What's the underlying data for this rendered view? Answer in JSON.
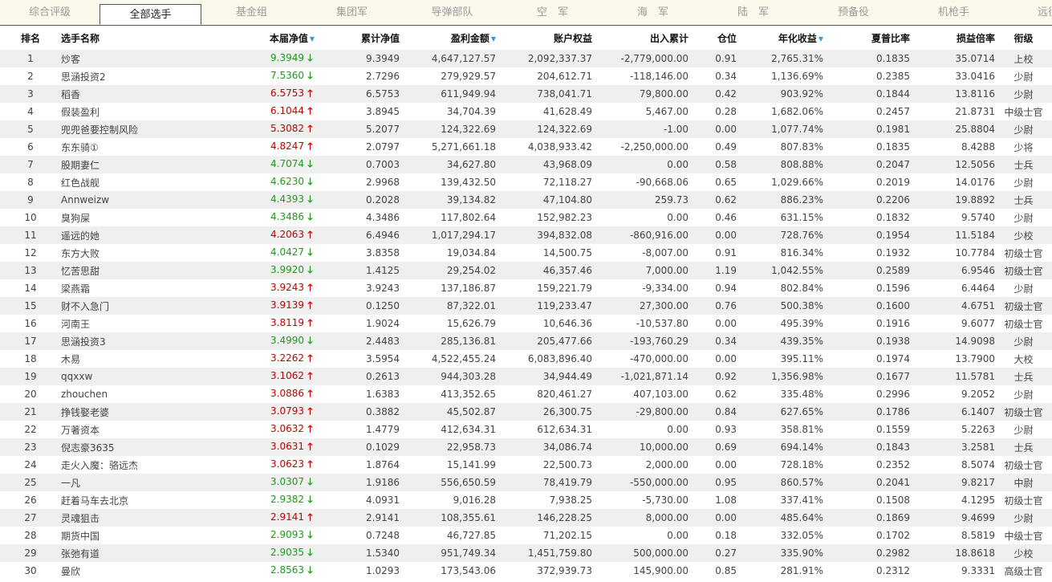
{
  "tabs": [
    "综合评级",
    "全部选手",
    "基金组",
    "集团军",
    "导弹部队",
    "空　军",
    "海　军",
    "陆　军",
    "预备役",
    "机枪手",
    "远征"
  ],
  "active_tab": 1,
  "headers": {
    "rank": "排名",
    "name": "选手名称",
    "nav": "本届净值",
    "cum": "累计净值",
    "profit": "盈利金额",
    "equity": "账户权益",
    "flow": "出入累计",
    "pos": "仓位",
    "annual": "年化收益",
    "sharpe": "夏普比率",
    "ratio": "损益倍率",
    "title": "衔级"
  },
  "colors": {
    "up": "#c00000",
    "down": "#1a9c1a",
    "sort": "#3399dd"
  },
  "rows": [
    {
      "rank": "1",
      "name": "炒客",
      "nav": "9.3949",
      "dir": "down",
      "cum": "9.3949",
      "profit": "4,647,127.57",
      "equity": "2,092,337.37",
      "flow": "-2,779,000.00",
      "pos": "0.91",
      "annual": "2,765.31%",
      "sharpe": "0.1835",
      "ratio": "35.0714",
      "title": "上校"
    },
    {
      "rank": "2",
      "name": "思涵投资2",
      "nav": "7.5360",
      "dir": "down",
      "cum": "2.7296",
      "profit": "279,929.57",
      "equity": "204,612.71",
      "flow": "-118,146.00",
      "pos": "0.34",
      "annual": "1,136.69%",
      "sharpe": "0.2385",
      "ratio": "33.0416",
      "title": "少尉"
    },
    {
      "rank": "3",
      "name": "稻香",
      "nav": "6.5753",
      "dir": "up",
      "cum": "6.5753",
      "profit": "611,949.94",
      "equity": "738,041.71",
      "flow": "79,800.00",
      "pos": "0.42",
      "annual": "903.92%",
      "sharpe": "0.1844",
      "ratio": "13.8116",
      "title": "少尉"
    },
    {
      "rank": "4",
      "name": "假装盈利",
      "nav": "6.1044",
      "dir": "up",
      "cum": "3.8945",
      "profit": "34,704.39",
      "equity": "41,628.49",
      "flow": "5,467.00",
      "pos": "0.28",
      "annual": "1,682.06%",
      "sharpe": "0.2457",
      "ratio": "21.8731",
      "title": "中级士官"
    },
    {
      "rank": "5",
      "name": "兜兜爸要控制风险",
      "nav": "5.3082",
      "dir": "up",
      "cum": "5.2077",
      "profit": "124,322.69",
      "equity": "124,322.69",
      "flow": "-1.00",
      "pos": "0.00",
      "annual": "1,077.74%",
      "sharpe": "0.1981",
      "ratio": "25.8804",
      "title": "少尉"
    },
    {
      "rank": "6",
      "name": "东东骑①",
      "nav": "4.8247",
      "dir": "up",
      "cum": "2.0797",
      "profit": "5,271,661.18",
      "equity": "4,038,933.42",
      "flow": "-2,250,000.00",
      "pos": "0.49",
      "annual": "807.83%",
      "sharpe": "0.1835",
      "ratio": "8.4288",
      "title": "少将"
    },
    {
      "rank": "7",
      "name": "股期妻仁",
      "nav": "4.7074",
      "dir": "down",
      "cum": "0.7003",
      "profit": "34,627.80",
      "equity": "43,968.09",
      "flow": "0.00",
      "pos": "0.58",
      "annual": "808.88%",
      "sharpe": "0.2047",
      "ratio": "12.5056",
      "title": "士兵"
    },
    {
      "rank": "8",
      "name": "红色战舰",
      "nav": "4.6230",
      "dir": "down",
      "cum": "2.9968",
      "profit": "139,432.50",
      "equity": "72,118.27",
      "flow": "-90,668.06",
      "pos": "0.65",
      "annual": "1,029.66%",
      "sharpe": "0.2019",
      "ratio": "14.0176",
      "title": "少尉"
    },
    {
      "rank": "9",
      "name": "Annweizw",
      "nav": "4.4393",
      "dir": "down",
      "cum": "0.2028",
      "profit": "39,134.82",
      "equity": "47,104.80",
      "flow": "259.73",
      "pos": "0.62",
      "annual": "886.23%",
      "sharpe": "0.2206",
      "ratio": "19.8892",
      "title": "士兵"
    },
    {
      "rank": "10",
      "name": "臭狗屎",
      "nav": "4.3486",
      "dir": "down",
      "cum": "4.3486",
      "profit": "117,802.64",
      "equity": "152,982.23",
      "flow": "0.00",
      "pos": "0.46",
      "annual": "631.15%",
      "sharpe": "0.1832",
      "ratio": "9.5740",
      "title": "少尉"
    },
    {
      "rank": "11",
      "name": "遥远的她",
      "nav": "4.2063",
      "dir": "up",
      "cum": "6.4946",
      "profit": "1,017,294.17",
      "equity": "394,832.08",
      "flow": "-860,916.00",
      "pos": "0.00",
      "annual": "728.76%",
      "sharpe": "0.1954",
      "ratio": "11.5184",
      "title": "少校"
    },
    {
      "rank": "12",
      "name": "东方大败",
      "nav": "4.0427",
      "dir": "down",
      "cum": "3.8358",
      "profit": "19,034.84",
      "equity": "14,500.75",
      "flow": "-8,007.00",
      "pos": "0.91",
      "annual": "816.34%",
      "sharpe": "0.1932",
      "ratio": "10.7784",
      "title": "初级士官"
    },
    {
      "rank": "13",
      "name": "忆苦思甜",
      "nav": "3.9920",
      "dir": "down",
      "cum": "1.4125",
      "profit": "29,254.02",
      "equity": "46,357.46",
      "flow": "7,000.00",
      "pos": "1.19",
      "annual": "1,042.55%",
      "sharpe": "0.2589",
      "ratio": "6.9546",
      "title": "初级士官"
    },
    {
      "rank": "14",
      "name": "梁燕霜",
      "nav": "3.9243",
      "dir": "up",
      "cum": "3.9243",
      "profit": "137,186.87",
      "equity": "159,221.79",
      "flow": "-9,334.00",
      "pos": "0.94",
      "annual": "802.84%",
      "sharpe": "0.1596",
      "ratio": "6.4464",
      "title": "少尉"
    },
    {
      "rank": "15",
      "name": "财不入急门",
      "nav": "3.9139",
      "dir": "up",
      "cum": "0.1250",
      "profit": "87,322.01",
      "equity": "119,233.47",
      "flow": "27,300.00",
      "pos": "0.76",
      "annual": "500.38%",
      "sharpe": "0.1600",
      "ratio": "4.6751",
      "title": "初级士官"
    },
    {
      "rank": "16",
      "name": "河南王",
      "nav": "3.8119",
      "dir": "up",
      "cum": "1.9024",
      "profit": "15,626.79",
      "equity": "10,646.36",
      "flow": "-10,537.80",
      "pos": "0.00",
      "annual": "495.39%",
      "sharpe": "0.1916",
      "ratio": "9.6077",
      "title": "初级士官"
    },
    {
      "rank": "17",
      "name": "思涵投资3",
      "nav": "3.4990",
      "dir": "down",
      "cum": "2.4483",
      "profit": "285,136.81",
      "equity": "205,477.66",
      "flow": "-193,760.29",
      "pos": "0.34",
      "annual": "439.35%",
      "sharpe": "0.1938",
      "ratio": "14.9098",
      "title": "少尉"
    },
    {
      "rank": "18",
      "name": "木易",
      "nav": "3.2262",
      "dir": "up",
      "cum": "3.5954",
      "profit": "4,522,455.24",
      "equity": "6,083,896.40",
      "flow": "-470,000.00",
      "pos": "0.00",
      "annual": "395.11%",
      "sharpe": "0.1974",
      "ratio": "13.7900",
      "title": "大校"
    },
    {
      "rank": "19",
      "name": "qqxxw",
      "nav": "3.1062",
      "dir": "up",
      "cum": "0.2613",
      "profit": "944,303.28",
      "equity": "34,944.49",
      "flow": "-1,021,871.14",
      "pos": "0.92",
      "annual": "1,356.98%",
      "sharpe": "0.1677",
      "ratio": "11.5781",
      "title": "士兵"
    },
    {
      "rank": "20",
      "name": "zhouchen",
      "nav": "3.0886",
      "dir": "up",
      "cum": "1.6383",
      "profit": "413,352.65",
      "equity": "820,461.27",
      "flow": "407,103.00",
      "pos": "0.62",
      "annual": "335.48%",
      "sharpe": "0.2996",
      "ratio": "9.2052",
      "title": "少尉"
    },
    {
      "rank": "21",
      "name": "挣钱娶老婆",
      "nav": "3.0793",
      "dir": "up",
      "cum": "0.3882",
      "profit": "45,502.87",
      "equity": "26,300.75",
      "flow": "-29,800.00",
      "pos": "0.84",
      "annual": "627.65%",
      "sharpe": "0.1786",
      "ratio": "6.1407",
      "title": "初级士官"
    },
    {
      "rank": "22",
      "name": "万著资本",
      "nav": "3.0632",
      "dir": "up",
      "cum": "1.4779",
      "profit": "412,634.31",
      "equity": "612,634.31",
      "flow": "0.00",
      "pos": "0.93",
      "annual": "358.81%",
      "sharpe": "0.1559",
      "ratio": "5.2263",
      "title": "少尉"
    },
    {
      "rank": "23",
      "name": "倪志豪3635",
      "nav": "3.0631",
      "dir": "up",
      "cum": "0.1029",
      "profit": "22,958.73",
      "equity": "34,086.74",
      "flow": "10,000.00",
      "pos": "0.69",
      "annual": "694.14%",
      "sharpe": "0.1843",
      "ratio": "3.2581",
      "title": "士兵"
    },
    {
      "rank": "24",
      "name": "走火入魔：骆远杰",
      "nav": "3.0623",
      "dir": "up",
      "cum": "1.8764",
      "profit": "15,141.99",
      "equity": "22,500.73",
      "flow": "2,000.00",
      "pos": "0.00",
      "annual": "728.18%",
      "sharpe": "0.2352",
      "ratio": "8.5074",
      "title": "初级士官"
    },
    {
      "rank": "25",
      "name": "一凡",
      "nav": "3.0307",
      "dir": "down",
      "cum": "1.9186",
      "profit": "556,650.59",
      "equity": "78,419.79",
      "flow": "-550,000.00",
      "pos": "0.95",
      "annual": "860.57%",
      "sharpe": "0.2041",
      "ratio": "9.8217",
      "title": "中尉"
    },
    {
      "rank": "26",
      "name": "赶着马车去北京",
      "nav": "2.9382",
      "dir": "down",
      "cum": "4.0931",
      "profit": "9,016.28",
      "equity": "7,938.25",
      "flow": "-5,730.00",
      "pos": "1.08",
      "annual": "337.41%",
      "sharpe": "0.1508",
      "ratio": "4.1295",
      "title": "初级士官"
    },
    {
      "rank": "27",
      "name": "灵魂狙击",
      "nav": "2.9141",
      "dir": "up",
      "cum": "2.9141",
      "profit": "108,355.61",
      "equity": "146,228.25",
      "flow": "8,000.00",
      "pos": "0.00",
      "annual": "485.64%",
      "sharpe": "0.1869",
      "ratio": "9.4699",
      "title": "少尉"
    },
    {
      "rank": "28",
      "name": "期货中国",
      "nav": "2.9093",
      "dir": "down",
      "cum": "0.7248",
      "profit": "46,727.85",
      "equity": "71,202.15",
      "flow": "0.00",
      "pos": "0.18",
      "annual": "332.05%",
      "sharpe": "0.1702",
      "ratio": "8.5819",
      "title": "中级士官"
    },
    {
      "rank": "29",
      "name": "张弛有道",
      "nav": "2.9035",
      "dir": "down",
      "cum": "1.5340",
      "profit": "951,749.34",
      "equity": "1,451,759.80",
      "flow": "500,000.00",
      "pos": "0.27",
      "annual": "335.90%",
      "sharpe": "0.2982",
      "ratio": "18.8618",
      "title": "少校"
    },
    {
      "rank": "30",
      "name": "曼欣",
      "nav": "2.8563",
      "dir": "down",
      "cum": "1.0293",
      "profit": "173,543.06",
      "equity": "372,939.73",
      "flow": "145,900.00",
      "pos": "0.85",
      "annual": "281.91%",
      "sharpe": "0.2312",
      "ratio": "9.3331",
      "title": "高级士官"
    }
  ]
}
